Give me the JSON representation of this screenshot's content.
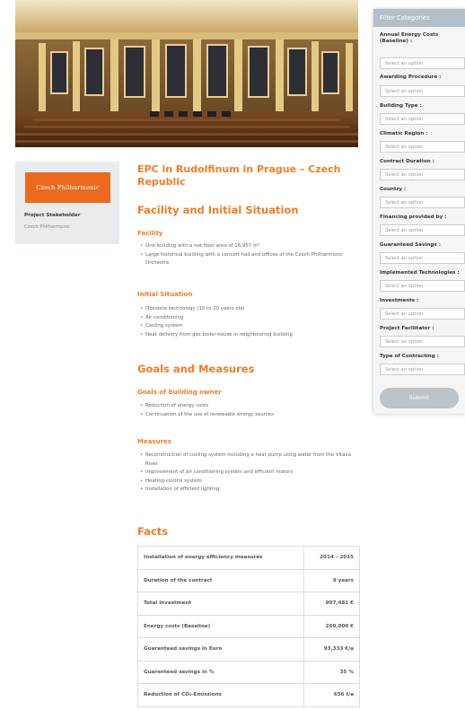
{
  "stakeholder": {
    "logo_text": "Czech Philharmonic",
    "label": "Project Stakeholder",
    "value": "Czech Philharmonic"
  },
  "article": {
    "title": "EPC in Rudolfinum in Prague – Czech Republic",
    "section1": "Facility and Initial Situation",
    "facility_heading": "Facility",
    "facility_items": [
      "One building with a net floor area of 16,957 m²",
      "Large historical building with a concert hall and offices of the Czech Philharmonic Orchestre"
    ],
    "initial_heading": "Initial Situation",
    "initial_items": [
      "Obsolete technology (10 to 20 years old)",
      "Air conditioning",
      "Cooling system",
      "Heat delivery from gas boiler-house in neighbouring building"
    ],
    "section2": "Goals and Measures",
    "goals_heading": "Goals of building owner",
    "goals_items": [
      "Reduction of energy costs",
      "Continuation of the use of renewable energy sources"
    ],
    "measures_heading": "Measures",
    "measures_items": [
      "Reconstruction of cooling system including a heat pump using water from the Vltava River",
      "Improvement of air conditioning system and efficient motors",
      "Heating control system",
      "Installation of efficient lighting"
    ],
    "section3": "Facts"
  },
  "facts": [
    {
      "label": "Installation of energy efficiency measures",
      "value": "2014 – 2015"
    },
    {
      "label": "Duration of the contract",
      "value": "9 years"
    },
    {
      "label": "Total Investment",
      "value": "907,481 €"
    },
    {
      "label": "Energy costs (Baseline)",
      "value": "269,000 €"
    },
    {
      "label": "Guaranteed savings in Euro",
      "value": "93,333 €/a"
    },
    {
      "label": "Guaranteed savings in %",
      "value": "35 %"
    },
    {
      "label": "Reduction of CO₂-Emissions",
      "value": "656 t/a"
    }
  ],
  "filter": {
    "title": "Filter Categories",
    "placeholder": "Select an option",
    "submit": "Submit",
    "fields": [
      "Annual Energy Costs (Baseline) :",
      "Awarding Procedure :",
      "Building Type :",
      "Climatic Region :",
      "Contract Duration :",
      "Country :",
      "Financing provided by :",
      "Guaranteed Savings :",
      "Implemented Technologies :",
      "Investments :",
      "Project Facilitator :",
      "Type of Contracting :"
    ]
  }
}
